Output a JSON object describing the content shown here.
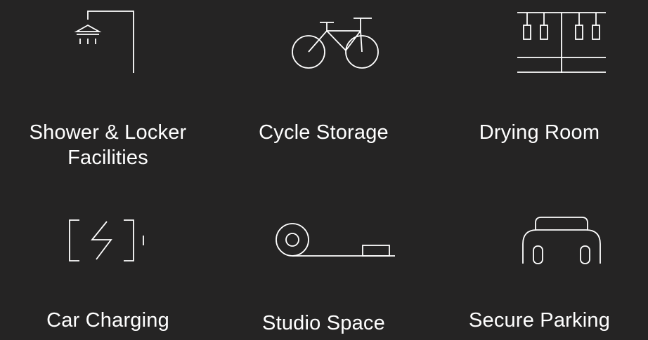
{
  "amenities": [
    {
      "label": "Shower & Locker\nFacilities",
      "icon": "shower-icon"
    },
    {
      "label": "Cycle Storage",
      "icon": "bicycle-icon"
    },
    {
      "label": "Drying Room",
      "icon": "drying-rack-icon"
    },
    {
      "label": "Car Charging",
      "icon": "battery-charging-icon"
    },
    {
      "label": "Studio Space",
      "icon": "tape-roll-icon"
    },
    {
      "label": "Secure Parking",
      "icon": "car-icon"
    }
  ],
  "colors": {
    "background": "#252424",
    "foreground": "#ffffff"
  }
}
